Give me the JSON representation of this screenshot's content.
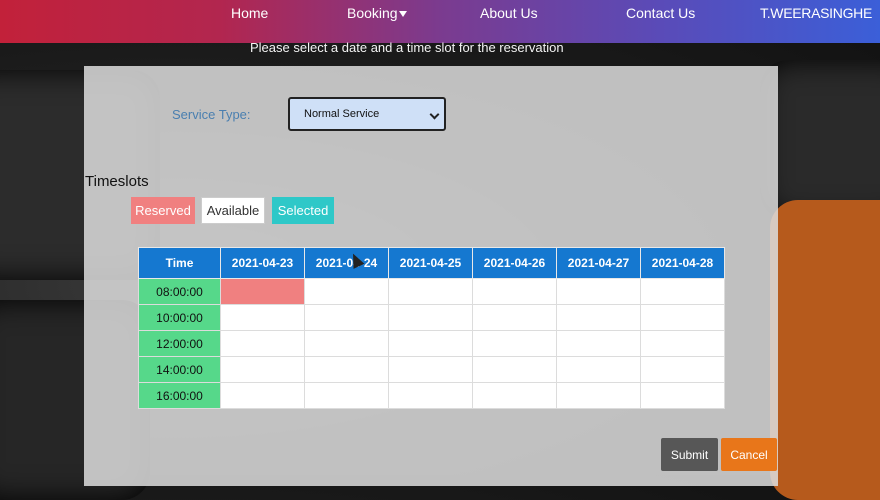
{
  "nav": {
    "home": "Home",
    "booking": "Booking",
    "about": "About Us",
    "contact": "Contact Us",
    "user": "T.WEERASINGHE"
  },
  "subtitle": "Please select a date and a time slot for the reservation",
  "service": {
    "label": "Service Type:",
    "selected": "Normal Service"
  },
  "timeslots": {
    "title": "Timeslots",
    "legend": {
      "reserved": "Reserved",
      "available": "Available",
      "selected": "Selected"
    },
    "colors": {
      "reserved": "#f08080",
      "available": "#ffffff",
      "selected": "#2ec8c8",
      "header": "#1578d0",
      "time_cell": "#56d88a"
    },
    "table": {
      "time_header": "Time",
      "dates": [
        "2021-04-23",
        "2021-04-24",
        "2021-04-25",
        "2021-04-26",
        "2021-04-27",
        "2021-04-28"
      ],
      "times": [
        "08:00:00",
        "10:00:00",
        "12:00:00",
        "14:00:00",
        "16:00:00"
      ],
      "reserved": [
        [
          0,
          0
        ]
      ]
    }
  },
  "buttons": {
    "submit": "Submit",
    "cancel": "Cancel"
  }
}
